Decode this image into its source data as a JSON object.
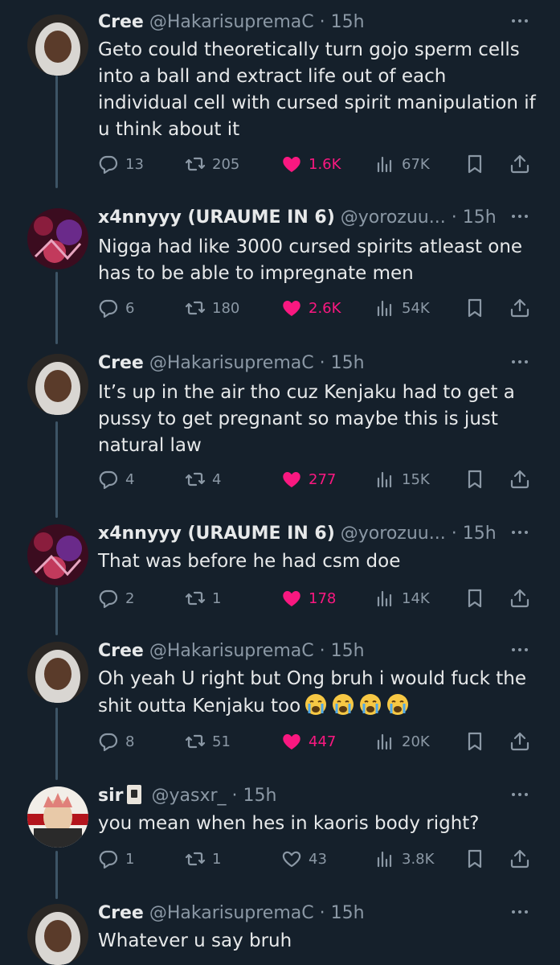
{
  "colors": {
    "background": "#15202b",
    "text_primary": "#e7e9ea",
    "text_secondary": "#8b98a5",
    "like_active": "#f91880",
    "thread_line": "#3d5466"
  },
  "tweets": [
    {
      "avatar": "cree-avatar",
      "name": "Cree",
      "handle": "@HakarisupremaC",
      "dot": "·",
      "time": "15h",
      "text": "Geto could theoretically turn gojo sperm cells into a ball and extract life out of each individual cell with cursed spirit manipulation if u think about it",
      "replies": "13",
      "retweets": "205",
      "likes": "1.6K",
      "liked": true,
      "views": "67K"
    },
    {
      "avatar": "x4nnyyy-avatar",
      "name": "x4nnyyy (URAUME IN 6)",
      "handle": "@yorozuu...",
      "dot": "·",
      "time": "15h",
      "text": "Nigga had like 3000 cursed spirits atleast one has to be able to impregnate men",
      "replies": "6",
      "retweets": "180",
      "likes": "2.6K",
      "liked": true,
      "views": "54K"
    },
    {
      "avatar": "cree-avatar",
      "name": "Cree",
      "handle": "@HakarisupremaC",
      "dot": "·",
      "time": "15h",
      "text": "It’s up in the air tho cuz Kenjaku had to get a pussy to get pregnant so maybe this is just natural law",
      "replies": "4",
      "retweets": "4",
      "likes": "277",
      "liked": true,
      "views": "15K"
    },
    {
      "avatar": "x4nnyyy-avatar",
      "name": "x4nnyyy (URAUME IN 6)",
      "handle": "@yorozuu...",
      "dot": "·",
      "time": "15h",
      "text": "That was before he had csm doe",
      "replies": "2",
      "retweets": "1",
      "likes": "178",
      "liked": true,
      "views": "14K"
    },
    {
      "avatar": "cree-avatar",
      "name": "Cree",
      "handle": "@HakarisupremaC",
      "dot": "·",
      "time": "15h",
      "text": "Oh yeah U right but Ong bruh i would fuck the shit outta Kenjaku too",
      "emojis": [
        "crying-face-emoji",
        "crying-face-emoji",
        "crying-face-emoji",
        "crying-face-emoji"
      ],
      "replies": "8",
      "retweets": "51",
      "likes": "447",
      "liked": true,
      "views": "20K"
    },
    {
      "avatar": "sir-avatar",
      "name": "sir",
      "name_icon": "joker-card-icon",
      "handle": "@yasxr_",
      "dot": "·",
      "time": "15h",
      "text": "you mean when hes in kaoris body right?",
      "replies": "1",
      "retweets": "1",
      "likes": "43",
      "liked": false,
      "views": "3.8K"
    },
    {
      "avatar": "cree-avatar",
      "name": "Cree",
      "handle": "@HakarisupremaC",
      "dot": "·",
      "time": "15h",
      "text": "Whatever u say bruh"
    }
  ]
}
